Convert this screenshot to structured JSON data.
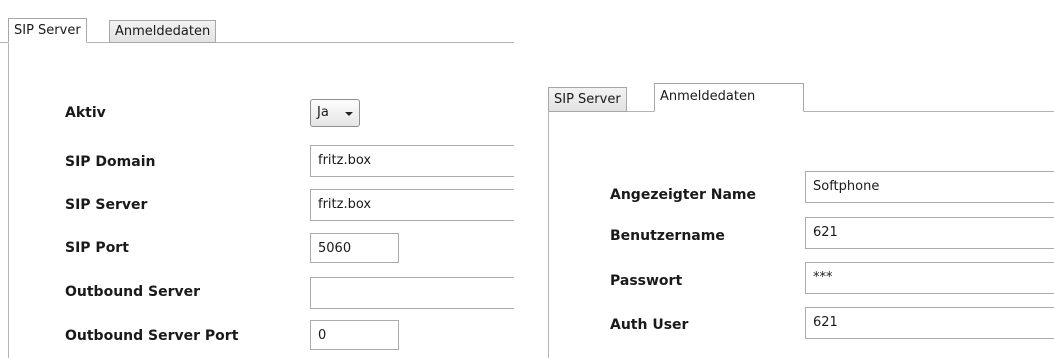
{
  "left_panel": {
    "tabs": [
      "SIP Server",
      "Anmeldedaten"
    ],
    "active_tab": "SIP Server",
    "fields": {
      "aktiv": {
        "label": "Aktiv",
        "value": "Ja"
      },
      "sip_domain": {
        "label": "SIP Domain",
        "value": "fritz.box"
      },
      "sip_server": {
        "label": "SIP Server",
        "value": "fritz.box"
      },
      "sip_port": {
        "label": "SIP Port",
        "value": "5060"
      },
      "outbound_server": {
        "label": "Outbound Server",
        "value": ""
      },
      "outbound_server_port": {
        "label": "Outbound Server Port",
        "value": "0"
      }
    }
  },
  "right_panel": {
    "tabs": [
      "SIP Server",
      "Anmeldedaten"
    ],
    "active_tab": "Anmeldedaten",
    "fields": {
      "angezeigter_name": {
        "label": "Angezeigter Name",
        "value": "Softphone"
      },
      "benutzername": {
        "label": "Benutzername",
        "value": "621"
      },
      "passwort": {
        "label": "Passwort",
        "value": "***"
      },
      "auth_user": {
        "label": "Auth User",
        "value": "621"
      }
    }
  }
}
